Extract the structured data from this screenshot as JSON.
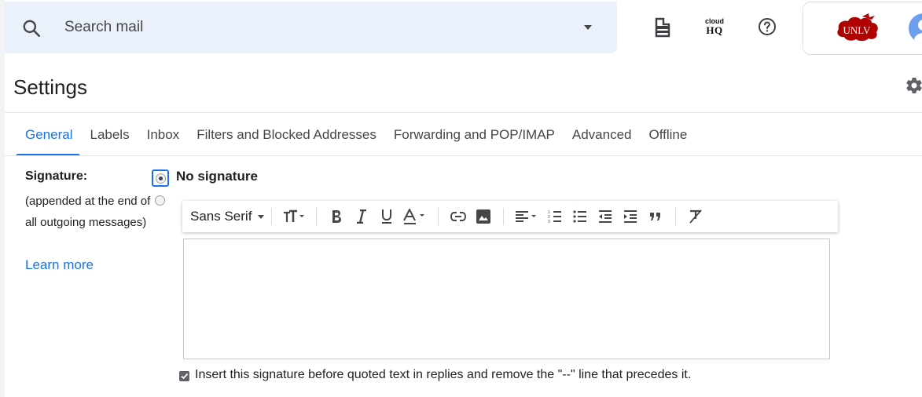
{
  "header": {
    "search_placeholder": "Search mail",
    "cloud_icon_line1": "cloud",
    "cloud_icon_line2": "HQ",
    "account_logo_text": "UNLV"
  },
  "settings": {
    "title": "Settings",
    "tabs": [
      {
        "label": "General",
        "active": true
      },
      {
        "label": "Labels",
        "active": false
      },
      {
        "label": "Inbox",
        "active": false
      },
      {
        "label": "Filters and Blocked Addresses",
        "active": false
      },
      {
        "label": "Forwarding and POP/IMAP",
        "active": false
      },
      {
        "label": "Advanced",
        "active": false
      },
      {
        "label": "Offline",
        "active": false
      }
    ]
  },
  "signature": {
    "label": "Signature:",
    "description": "(appended at the end of all outgoing messages)",
    "learn_more": "Learn more",
    "no_signature_label": "No signature",
    "selected_option": "No signature",
    "toolbar": {
      "font": "Sans Serif",
      "buttons": [
        "font-size",
        "bold",
        "italic",
        "underline",
        "text-color",
        "link",
        "image",
        "align",
        "numbered-list",
        "bulleted-list",
        "indent-less",
        "indent-more",
        "quote",
        "remove-formatting"
      ]
    },
    "insert_before_quoted_label": "Insert this signature before quoted text in replies and remove the \"--\" line that precedes it.",
    "insert_before_quoted_checked": true
  },
  "colors": {
    "accent": "#1a73e8",
    "search_bg": "#eaf1fb",
    "univ_red": "#b10202"
  }
}
